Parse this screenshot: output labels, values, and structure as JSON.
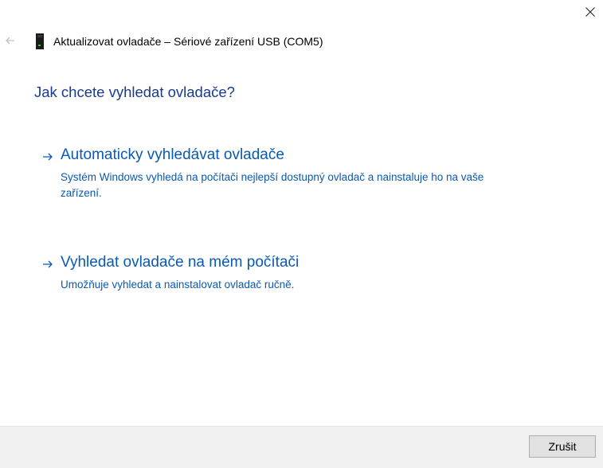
{
  "window": {
    "title": "Aktualizovat ovladače – Sériové zařízení USB (COM5)",
    "close_icon": "close-icon",
    "back_icon": "back-arrow-icon",
    "device_icon": "usb-device-icon"
  },
  "main": {
    "heading": "Jak chcete vyhledat ovladače?",
    "options": [
      {
        "title": "Automaticky vyhledávat ovladače",
        "description": "Systém Windows vyhledá na počítači nejlepší dostupný ovladač a nainstaluje ho na vaše zařízení.",
        "icon": "arrow-right-icon"
      },
      {
        "title": "Vyhledat ovladače na mém počítači",
        "description": "Umožňuje vyhledat a nainstalovat ovladač ručně.",
        "icon": "arrow-right-icon"
      }
    ]
  },
  "footer": {
    "cancel_label": "Zrušit"
  },
  "colors": {
    "heading": "#1a3a8c",
    "link": "#0a59b2",
    "footer_bg": "#f0f0f0",
    "button_bg": "#e1e1e1"
  }
}
